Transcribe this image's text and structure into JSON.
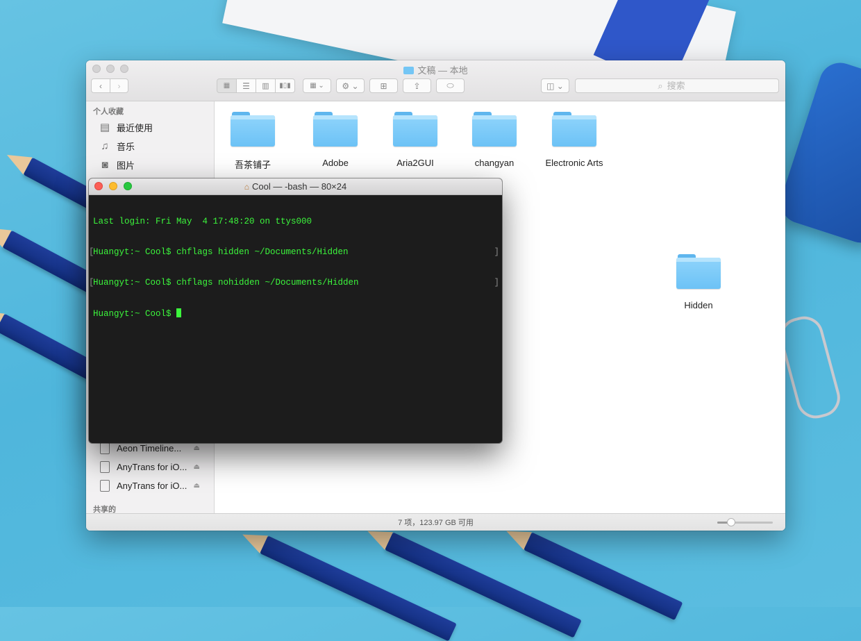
{
  "finder": {
    "title": "文稿 — 本地",
    "search_placeholder": "搜索",
    "sidebar": {
      "favorites_heading": "个人收藏",
      "items": [
        {
          "label": "最近使用",
          "icon": "recent-icon"
        },
        {
          "label": "音乐",
          "icon": "music-note-icon"
        },
        {
          "label": "图片",
          "icon": "camera-icon"
        }
      ],
      "devices": [
        {
          "label": "Aeon Timeline...",
          "icon": "disk-icon"
        },
        {
          "label": "AnyTrans for iO...",
          "icon": "disk-icon"
        },
        {
          "label": "AnyTrans for iO...",
          "icon": "disk-icon"
        }
      ],
      "shared_heading": "共享的"
    },
    "folders": [
      {
        "label": "吾茶铺子"
      },
      {
        "label": "Adobe"
      },
      {
        "label": "Aria2GUI"
      },
      {
        "label": "changyan"
      },
      {
        "label": "Electronic Arts"
      },
      {
        "label": "Hidden"
      }
    ],
    "status": "7 项，123.97 GB 可用",
    "icon_size_slider": 0.25
  },
  "terminal": {
    "title": "Cool — -bash — 80×24",
    "lines": [
      "Last login: Fri May  4 17:48:20 on ttys000",
      "Huangyt:~ Cool$ chflags hidden ~/Documents/Hidden",
      "Huangyt:~ Cool$ chflags nohidden ~/Documents/Hidden",
      "Huangyt:~ Cool$ "
    ]
  },
  "colors": {
    "terminal_text": "#3cf53c",
    "terminal_bg": "#1c1c1c",
    "folder_blue": "#6cc2f6"
  }
}
